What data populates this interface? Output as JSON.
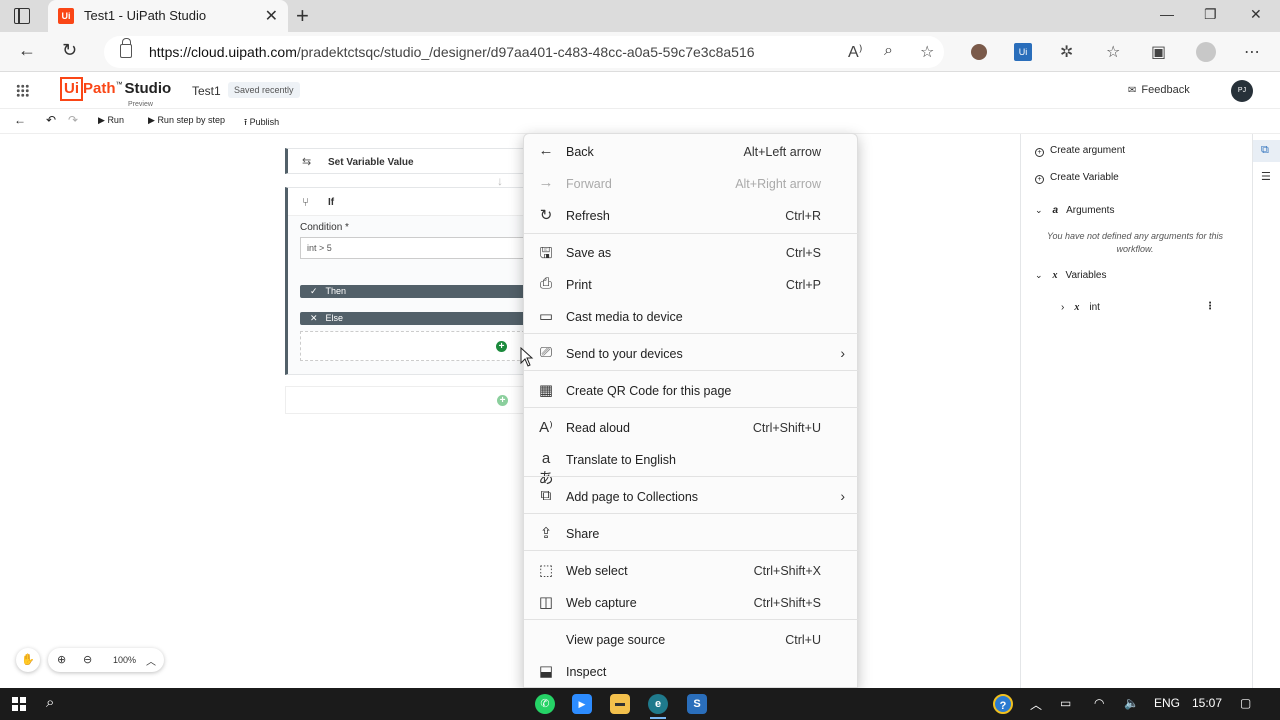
{
  "browser": {
    "tab_title": "Test1 - UiPath Studio",
    "tab_favicon": "Ui",
    "url_host": "https://cloud.uipath.com",
    "url_path": "/pradektctsqc/studio_/designer/d97aa401-c483-48cc-a0a5-59c7e3c8a516",
    "toolbar_icons": [
      "read-aloud-icon",
      "zoom-icon",
      "favorite-add-icon",
      "profile-icon",
      "uipath-extension-icon",
      "extensions-icon",
      "favorites-icon",
      "collections-icon",
      "account-icon",
      "more-icon"
    ]
  },
  "app": {
    "logo_ui": "Ui",
    "logo_path": "Path",
    "logo_tm": "™",
    "logo_studio": "Studio",
    "logo_preview": "Preview",
    "project_name": "Test1",
    "save_status": "Saved recently",
    "feedback_label": "Feedback",
    "avatar_initials": "PJ",
    "accent": "#fa4616"
  },
  "toolbar": {
    "run": "Run",
    "run_step": "Run step by step",
    "publish": "Publish"
  },
  "designer": {
    "set_variable": "Set Variable Value",
    "if_label": "If",
    "condition_label": "Condition *",
    "condition_value": "int > 5",
    "then_label": "Then",
    "else_label": "Else"
  },
  "zoom": {
    "level": "100%"
  },
  "right_panel": {
    "create_argument": "Create argument",
    "create_variable": "Create Variable",
    "arguments_header": "Arguments",
    "arguments_empty": "You have not defined any arguments for this workflow.",
    "variables_header": "Variables",
    "variable_name": "int"
  },
  "context_menu": {
    "items": [
      {
        "label": "Back",
        "shortcut": "Alt+Left arrow",
        "icon": "back-arrow-icon"
      },
      {
        "label": "Forward",
        "shortcut": "Alt+Right arrow",
        "icon": "forward-arrow-icon"
      },
      {
        "label": "Refresh",
        "shortcut": "Ctrl+R",
        "icon": "refresh-icon"
      },
      {
        "label": "Save as",
        "shortcut": "Ctrl+S",
        "icon": "save-icon"
      },
      {
        "label": "Print",
        "shortcut": "Ctrl+P",
        "icon": "print-icon"
      },
      {
        "label": "Cast media to device",
        "shortcut": "",
        "icon": "cast-icon"
      },
      {
        "label": "Send to your devices",
        "shortcut": "",
        "icon": "devices-icon"
      },
      {
        "label": "Create QR Code for this page",
        "shortcut": "",
        "icon": "qr-code-icon"
      },
      {
        "label": "Read aloud",
        "shortcut": "Ctrl+Shift+U",
        "icon": "read-aloud-icon"
      },
      {
        "label": "Translate to English",
        "shortcut": "",
        "icon": "translate-icon"
      },
      {
        "label": "Add page to Collections",
        "shortcut": "",
        "icon": "collections-icon"
      },
      {
        "label": "Share",
        "shortcut": "",
        "icon": "share-icon"
      },
      {
        "label": "Web select",
        "shortcut": "Ctrl+Shift+X",
        "icon": "web-select-icon"
      },
      {
        "label": "Web capture",
        "shortcut": "Ctrl+Shift+S",
        "icon": "web-capture-icon"
      },
      {
        "label": "View page source",
        "shortcut": "Ctrl+U",
        "icon": ""
      },
      {
        "label": "Inspect",
        "shortcut": "",
        "icon": "inspect-icon"
      }
    ]
  },
  "taskbar": {
    "language": "ENG",
    "time": "15:07"
  }
}
